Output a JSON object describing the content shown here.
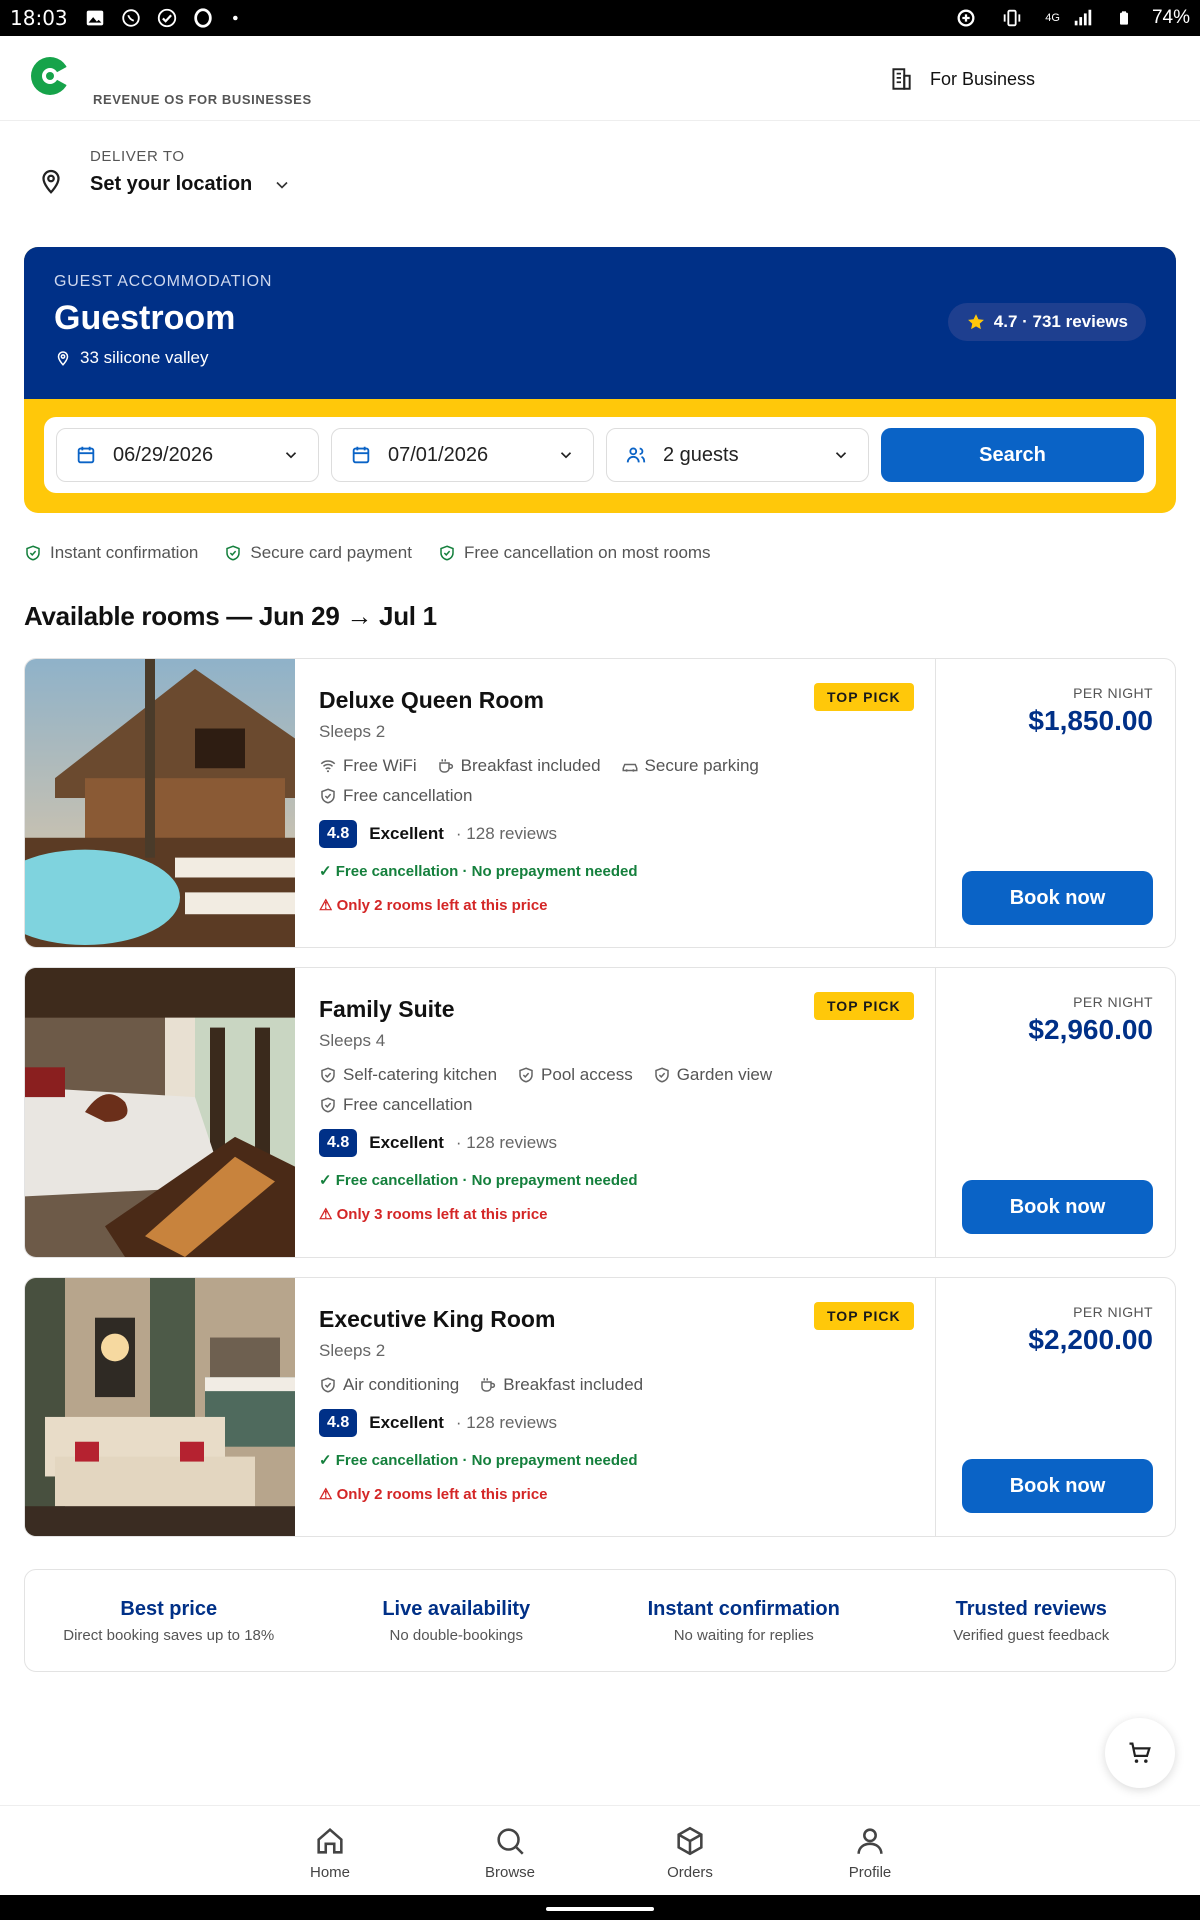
{
  "status_bar": {
    "time": "18:03",
    "network": "4G",
    "battery": "74%"
  },
  "header": {
    "tagline": "REVENUE OS FOR BUSINESSES",
    "for_business_label": "For Business",
    "brand_color": "#16a34a"
  },
  "deliver": {
    "label": "DELIVER TO",
    "value": "Set your location"
  },
  "hero": {
    "eyebrow": "GUEST ACCOMMODATION",
    "title": "Guestroom",
    "location": "33 silicone valley",
    "rating": "4.7 · 731 reviews",
    "colors": {
      "primary": "#003087",
      "accent": "#ffc80a",
      "button": "#0a63c6"
    }
  },
  "search": {
    "checkin": "06/29/2026",
    "checkout": "07/01/2026",
    "guests": "2 guests",
    "button_label": "Search"
  },
  "trust_badges": [
    "Instant confirmation",
    "Secure card payment",
    "Free cancellation on most rooms"
  ],
  "rooms_title": "Available rooms — Jun 29 → Jul 1",
  "rooms": [
    {
      "name": "Deluxe Queen Room",
      "sleeps": "Sleeps 2",
      "badge": "TOP PICK",
      "amenities": [
        {
          "icon": "wifi-icon",
          "label": "Free WiFi"
        },
        {
          "icon": "coffee-icon",
          "label": "Breakfast included"
        },
        {
          "icon": "car-icon",
          "label": "Secure parking"
        },
        {
          "icon": "shield-icon",
          "label": "Free cancellation"
        }
      ],
      "score": "4.8",
      "score_label": "Excellent",
      "reviews": "· 128 reviews",
      "free_cancel": "✓ Free cancellation · No prepayment needed",
      "rooms_left": "⚠ Only 2 rooms left at this price",
      "per_night": "PER NIGHT",
      "price": "$1,850.00",
      "book_label": "Book now"
    },
    {
      "name": "Family Suite",
      "sleeps": "Sleeps 4",
      "badge": "TOP PICK",
      "amenities": [
        {
          "icon": "shield-icon",
          "label": "Self-catering kitchen"
        },
        {
          "icon": "shield-icon",
          "label": "Pool access"
        },
        {
          "icon": "shield-icon",
          "label": "Garden view"
        },
        {
          "icon": "shield-icon",
          "label": "Free cancellation"
        }
      ],
      "score": "4.8",
      "score_label": "Excellent",
      "reviews": "· 128 reviews",
      "free_cancel": "✓ Free cancellation · No prepayment needed",
      "rooms_left": "⚠ Only 3 rooms left at this price",
      "per_night": "PER NIGHT",
      "price": "$2,960.00",
      "book_label": "Book now"
    },
    {
      "name": "Executive King Room",
      "sleeps": "Sleeps 2",
      "badge": "TOP PICK",
      "amenities": [
        {
          "icon": "shield-icon",
          "label": "Air conditioning"
        },
        {
          "icon": "coffee-icon",
          "label": "Breakfast included"
        }
      ],
      "score": "4.8",
      "score_label": "Excellent",
      "reviews": "· 128 reviews",
      "free_cancel": "✓ Free cancellation · No prepayment needed",
      "rooms_left": "⚠ Only 2 rooms left at this price",
      "per_night": "PER NIGHT",
      "price": "$2,200.00",
      "book_label": "Book now"
    }
  ],
  "benefits": [
    {
      "title": "Best price",
      "subtitle": "Direct booking saves up to 18%"
    },
    {
      "title": "Live availability",
      "subtitle": "No double-bookings"
    },
    {
      "title": "Instant confirmation",
      "subtitle": "No waiting for replies"
    },
    {
      "title": "Trusted reviews",
      "subtitle": "Verified guest feedback"
    }
  ],
  "bottom_nav": [
    {
      "icon": "home-icon",
      "label": "Home"
    },
    {
      "icon": "search-icon",
      "label": "Browse"
    },
    {
      "icon": "box-icon",
      "label": "Orders"
    },
    {
      "icon": "person-icon",
      "label": "Profile"
    }
  ]
}
